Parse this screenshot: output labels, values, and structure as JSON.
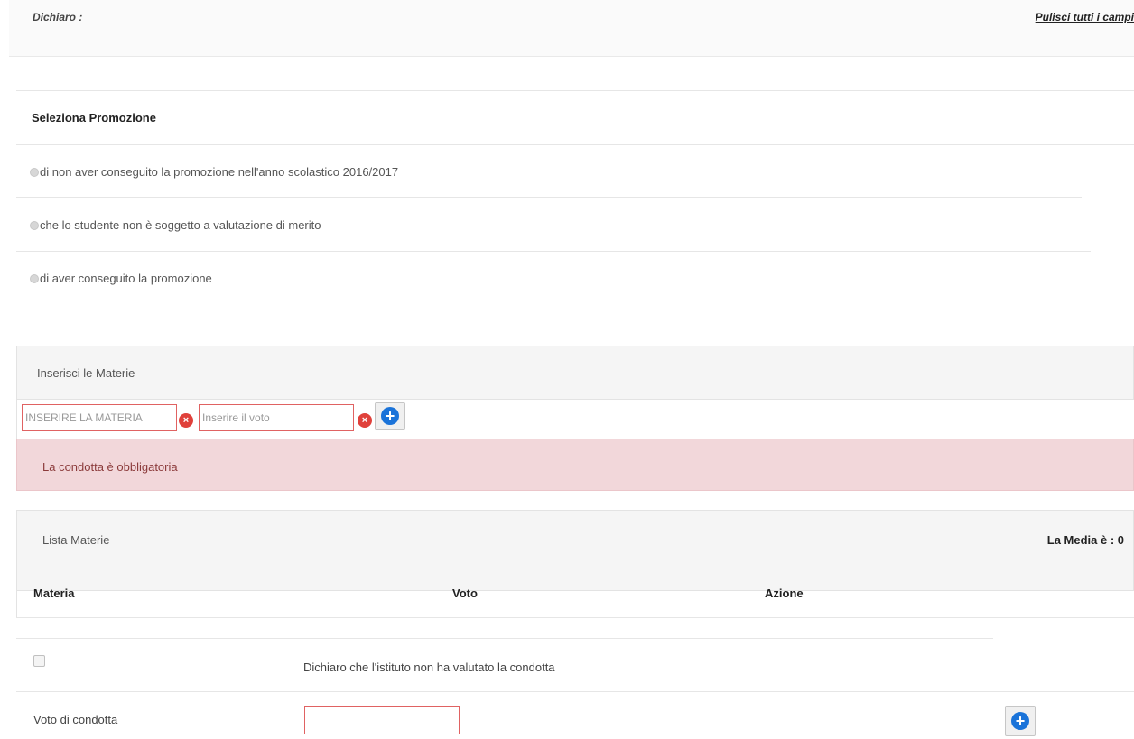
{
  "header": {
    "dichiaro_label": "Dichiaro :",
    "clear_link": "Pulisci tutti i campi"
  },
  "promozione": {
    "title": "Seleziona Promozione",
    "options": [
      "di non aver conseguito la promozione nell'anno scolastico 2016/2017",
      "che lo studente non è soggetto a valutazione di merito",
      "di aver conseguito la promozione"
    ]
  },
  "materie_form": {
    "panel_title": "Inserisci le Materie",
    "materia_value": "INSERIRE LA MATERIA",
    "voto_placeholder": "Inserire il voto",
    "remove_icon": "x-icon",
    "add_icon": "plus-circle-icon"
  },
  "alert": {
    "message": "La condotta è obbligatoria"
  },
  "lista": {
    "title": "Lista Materie",
    "media_label": "La Media è : 0",
    "columns": [
      "Materia",
      "Voto",
      "Azione"
    ]
  },
  "condotta": {
    "not_evaluated_label": "Dichiaro che l'istituto non ha valutato la condotta",
    "voto_label": "Voto di condotta",
    "voto_value": ""
  },
  "colors": {
    "error_border": "#e06262",
    "alert_bg": "#f2d7da",
    "accent_blue": "#1a73d9",
    "error_icon": "#e0413b"
  }
}
